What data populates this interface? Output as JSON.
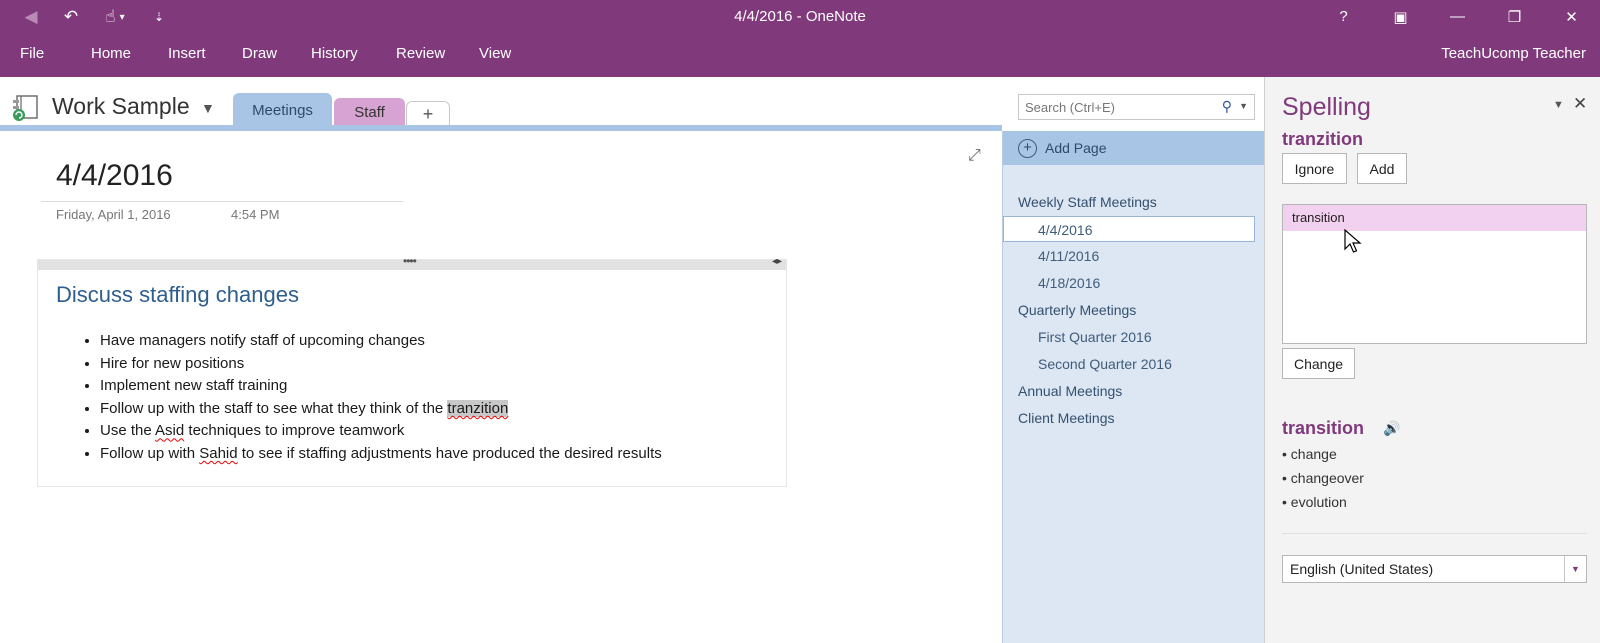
{
  "window": {
    "title": "4/4/2016 - OneNote",
    "controls": [
      "?",
      "▣",
      "—",
      "❐",
      "✕"
    ]
  },
  "qat": {
    "back": "◀",
    "undo": "↶",
    "touch": "☝",
    "touch_caret": "▾",
    "customize": "⇣"
  },
  "ribbon": {
    "tabs": [
      "File",
      "Home",
      "Insert",
      "Draw",
      "History",
      "Review",
      "View"
    ],
    "user": "TeachUcomp Teacher"
  },
  "notebook": {
    "name": "Work Sample",
    "sections": [
      {
        "label": "Meetings",
        "color": "#a9c5e6"
      },
      {
        "label": "Staff",
        "color": "#d7a3d2"
      }
    ],
    "add_section": "+",
    "search_placeholder": "Search (Ctrl+E)"
  },
  "page": {
    "title": "4/4/2016",
    "date": "Friday, April 1, 2016",
    "time": "4:54 PM",
    "heading": "Discuss staffing changes",
    "bullets": [
      "Have managers notify staff of upcoming changes",
      "Hire for new positions",
      "Implement new staff training"
    ],
    "bullet4_pre": "Follow up with the staff to see what they think of the ",
    "bullet4_word": "tranzition",
    "bullet5_pre": "Use the ",
    "bullet5_word": "Asid",
    "bullet5_post": " techniques to improve teamwork",
    "bullet6_pre": "Follow up with ",
    "bullet6_word": "Sahid",
    "bullet6_post": " to see if staffing adjustments have produced the desired results"
  },
  "pages": {
    "add_page": "Add Page",
    "items": [
      {
        "label": "Weekly Staff Meetings",
        "level": 0
      },
      {
        "label": "4/4/2016",
        "level": 1,
        "selected": true
      },
      {
        "label": "4/11/2016",
        "level": 1
      },
      {
        "label": "4/18/2016",
        "level": 1
      },
      {
        "label": "Quarterly Meetings",
        "level": 0
      },
      {
        "label": "First Quarter 2016",
        "level": 1
      },
      {
        "label": "Second Quarter 2016",
        "level": 1
      },
      {
        "label": "Annual Meetings",
        "level": 0
      },
      {
        "label": "Client Meetings",
        "level": 0
      }
    ]
  },
  "spelling": {
    "title": "Spelling",
    "misspelled_word": "tranzition",
    "ignore_label": "Ignore",
    "add_label": "Add",
    "suggestions": [
      "transition"
    ],
    "change_label": "Change",
    "definition_word": "transition",
    "synonyms": [
      "change",
      "changeover",
      "evolution"
    ],
    "language": "English (United States)"
  }
}
